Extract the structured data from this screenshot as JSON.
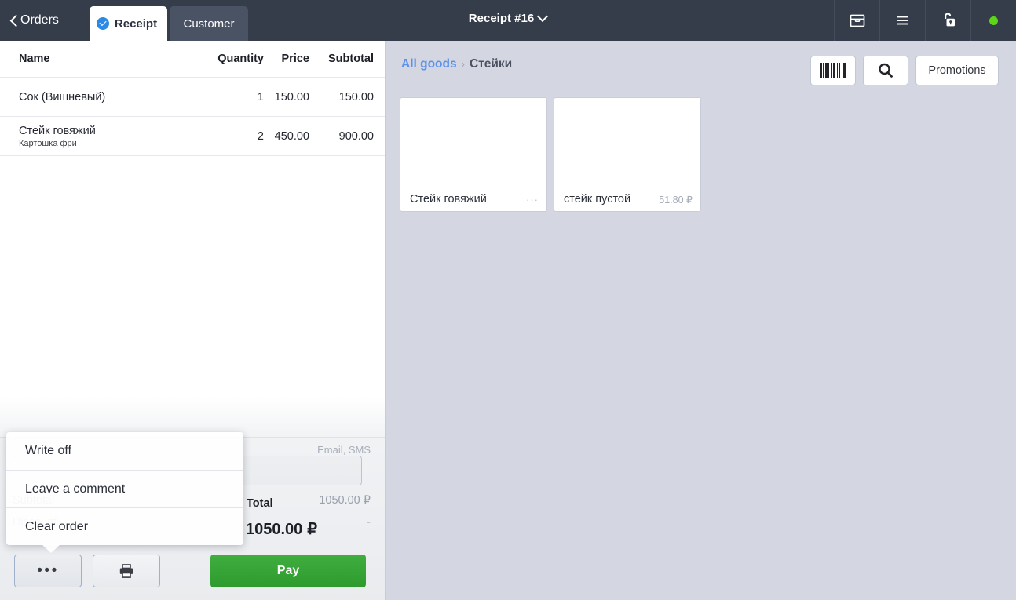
{
  "header": {
    "back_label": "Orders",
    "tabs": [
      {
        "label": "Receipt",
        "icon": "check-circle-icon",
        "active": true
      },
      {
        "label": "Customer",
        "icon": null,
        "active": false
      }
    ],
    "receipt_title": "Receipt #16",
    "dropdown_icon": "chevron-down-icon",
    "icons": [
      {
        "name": "cash-drawer-icon"
      },
      {
        "name": "hamburger-menu-icon"
      },
      {
        "name": "unlock-icon"
      },
      {
        "name": "status-online-dot"
      }
    ],
    "background_color": "#353c4a",
    "status_dot_color": "#5ed41a"
  },
  "receipt": {
    "columns": {
      "name": "Name",
      "quantity": "Quantity",
      "price": "Price",
      "subtotal": "Subtotal"
    },
    "items": [
      {
        "name": "Сок (Вишневый)",
        "modifier": "",
        "quantity": "1",
        "price": "150.00",
        "subtotal": "150.00"
      },
      {
        "name": "Стейк говяжий",
        "modifier": "Картошка фри",
        "quantity": "2",
        "price": "450.00",
        "subtotal": "900.00"
      }
    ],
    "comment_placeholder": "",
    "email_sms_label": "Email, SMS",
    "subtotal_label": "Subtotal",
    "subtotal_value": "1050.00 ₽",
    "discount_label": "Discount",
    "discount_value": "-",
    "total_label": "Total",
    "total_value": "1050.00",
    "total_currency": "₽"
  },
  "actions": {
    "more_icon": "ellipsis-icon",
    "more_dots": "•••",
    "print_icon": "printer-icon",
    "pay_label": "Pay",
    "pay_color": "#34a234"
  },
  "popup_menu": {
    "items": [
      {
        "label": "Write off"
      },
      {
        "label": "Leave a comment"
      },
      {
        "label": "Clear order"
      }
    ]
  },
  "catalog": {
    "breadcrumb": {
      "root": "All goods",
      "separator": "›",
      "current": "Стейки"
    },
    "tools": [
      {
        "name": "barcode-scan-button",
        "icon": "barcode-icon",
        "label": ""
      },
      {
        "name": "search-button",
        "icon": "search-icon",
        "label": ""
      },
      {
        "name": "promotions-button",
        "icon": null,
        "label": "Promotions"
      }
    ],
    "products": [
      {
        "name": "Стейк говяжий",
        "price": "···"
      },
      {
        "name": "стейк пустой",
        "price": "51.80 ₽"
      }
    ],
    "background_color": "#d4d7e2"
  }
}
